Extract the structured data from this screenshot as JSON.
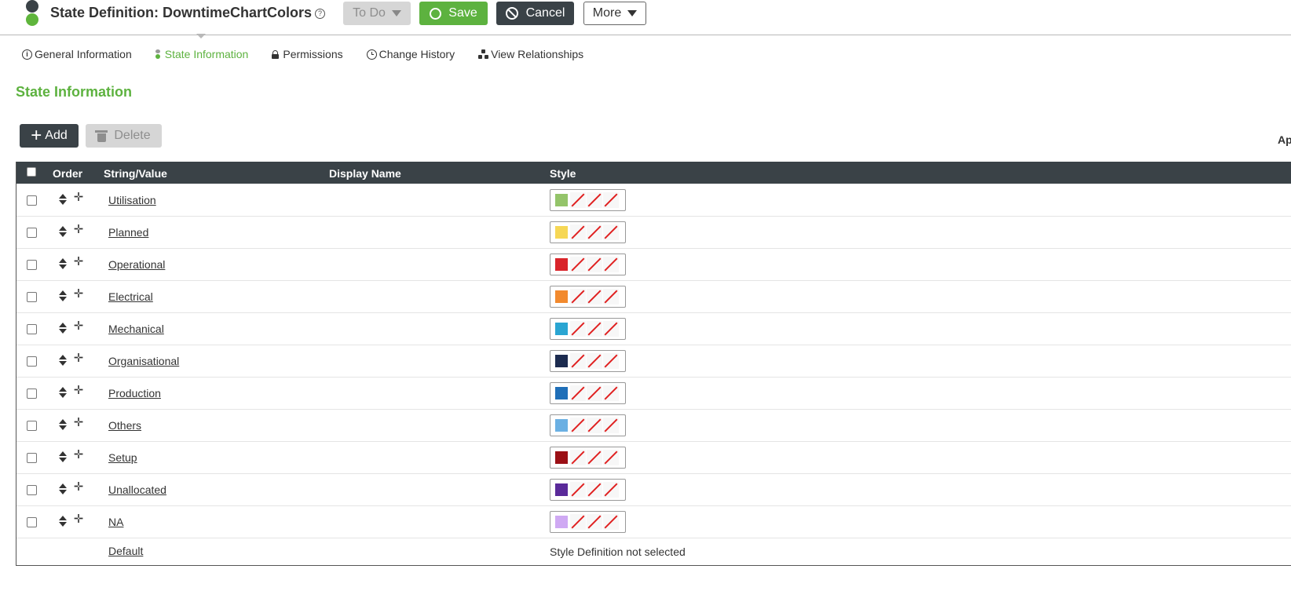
{
  "header": {
    "title": "State Definition: DowntimeChartColors",
    "help_icon": "?",
    "todo_label": "To Do",
    "save_label": "Save",
    "cancel_label": "Cancel",
    "more_label": "More"
  },
  "tabs": [
    {
      "label": "General Information",
      "icon": "info-icon"
    },
    {
      "label": "State Information",
      "icon": "state-icon",
      "active": true
    },
    {
      "label": "Permissions",
      "icon": "lock-icon"
    },
    {
      "label": "Change History",
      "icon": "clock-icon"
    },
    {
      "label": "View Relationships",
      "icon": "relationships-icon"
    }
  ],
  "section": {
    "title": "State Information",
    "add_label": "Add",
    "delete_label": "Delete",
    "right_label": "Ap"
  },
  "table": {
    "columns": {
      "order": "Order",
      "string_value": "String/Value",
      "display_name": "Display Name",
      "style": "Style"
    },
    "rows": [
      {
        "value": "Utilisation",
        "display_name": "",
        "color": "#94c46a"
      },
      {
        "value": "Planned",
        "display_name": "",
        "color": "#f6d755"
      },
      {
        "value": "Operational",
        "display_name": "",
        "color": "#d9242a"
      },
      {
        "value": "Electrical",
        "display_name": "",
        "color": "#f28a2e"
      },
      {
        "value": "Mechanical",
        "display_name": "",
        "color": "#2aa5d2"
      },
      {
        "value": "Organisational",
        "display_name": "",
        "color": "#1c2b4f"
      },
      {
        "value": "Production",
        "display_name": "",
        "color": "#1f6fb8"
      },
      {
        "value": "Others",
        "display_name": "",
        "color": "#6bb0e3"
      },
      {
        "value": "Setup",
        "display_name": "",
        "color": "#9b1016"
      },
      {
        "value": "Unallocated",
        "display_name": "",
        "color": "#5a2a9a"
      },
      {
        "value": "NA",
        "display_name": "",
        "color": "#cfa9f3"
      }
    ],
    "default_row": {
      "value": "Default",
      "style_text": "Style Definition not selected"
    }
  }
}
